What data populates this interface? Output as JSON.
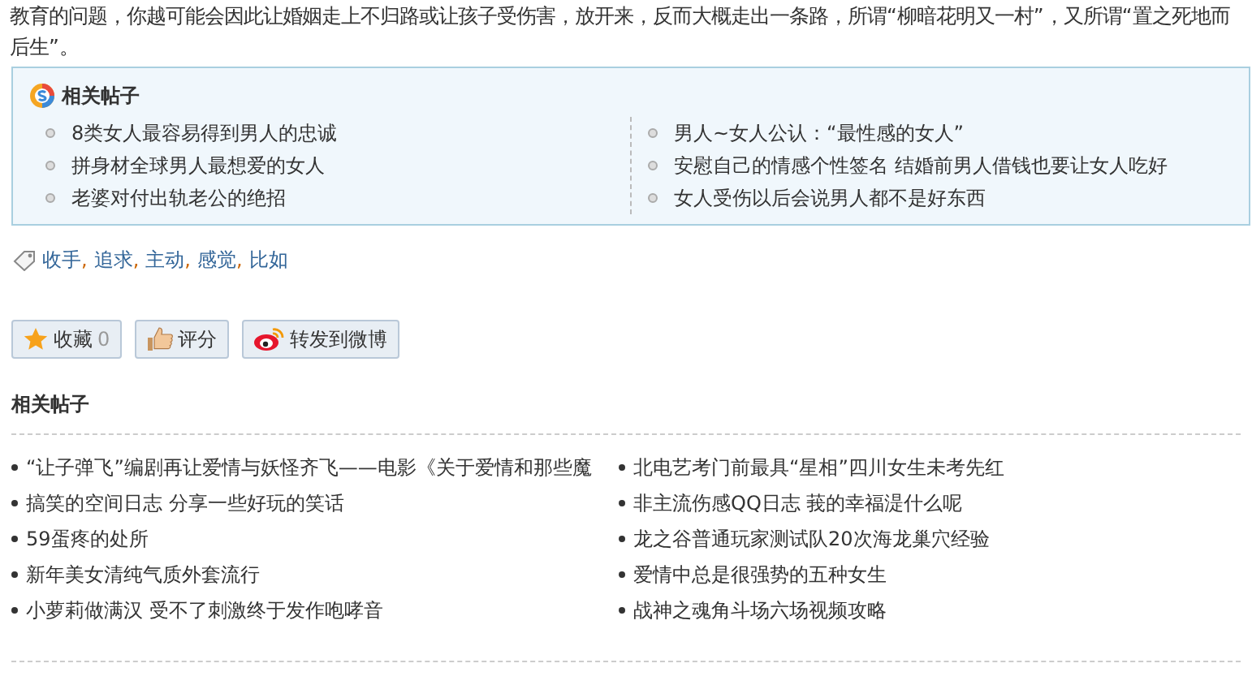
{
  "article_text": "教育的问题，你越可能会因此让婚姻走上不归路或让孩子受伤害，放开来，反而大概走出一条路，所谓“柳暗花明又一村”，又所谓“置之死地而后生”。",
  "related_box": {
    "title": "相关帖子",
    "left": [
      "8类女人最容易得到男人的忠诚",
      "拼身材全球男人最想爱的女人",
      "老婆对付出轨老公的绝招"
    ],
    "right": [
      "男人~女人公认：“最性感的女人”",
      "安慰自己的情感个性签名 结婚前男人借钱也要让女人吃好",
      "女人受伤以后会说男人都不是好东西"
    ]
  },
  "tags": [
    "收手",
    "追求",
    "主动",
    "感觉",
    "比如"
  ],
  "tag_separator": ",",
  "actions": [
    {
      "kind": "favorite",
      "label": "收藏",
      "count": "0"
    },
    {
      "kind": "rate",
      "label": "评分"
    },
    {
      "kind": "weibo",
      "label": "转发到微博"
    }
  ],
  "related_posts": {
    "title": "相关帖子",
    "left": [
      "“让子弹飞”编剧再让爱情与妖怪齐飞——电影《关于爱情和那些魔",
      "搞笑的空间日志 分享一些好玩的笑话",
      "59蛋疼的处所",
      "新年美女清纯气质外套流行",
      "小萝莉做满汉 受不了刺激终于发作咆哮音"
    ],
    "right": [
      "北电艺考门前最具“星相”四川女生未考先红",
      "非主流伤感QQ日志 莪的幸福湜什么呢",
      "龙之谷普通玩家测试队20次海龙巢穴经验",
      "爱情中总是很强势的五种女生",
      "战神之魂角斗场六场视频攻略"
    ]
  }
}
